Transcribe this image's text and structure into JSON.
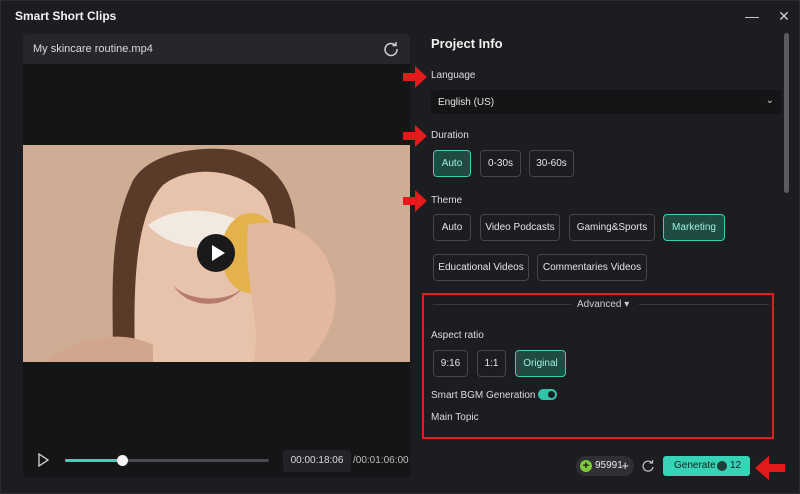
{
  "window": {
    "title": "Smart Short Clips",
    "minimize_label": "—",
    "close_label": "✕"
  },
  "video": {
    "file_name": "My skincare routine.mp4",
    "progress_fraction": 0.28,
    "current_time": "00:00:18:06",
    "total_time": "/00:01:06:00"
  },
  "project": {
    "title": "Project Info",
    "language": {
      "label": "Language",
      "value": "English (US)"
    },
    "duration": {
      "label": "Duration",
      "options": [
        "Auto",
        "0-30s",
        "30-60s"
      ],
      "selected": "Auto"
    },
    "theme": {
      "label": "Theme",
      "options": [
        "Auto",
        "Video Podcasts",
        "Gaming&Sports",
        "Marketing",
        "Educational Videos",
        "Commentaries Videos"
      ],
      "selected": "Marketing"
    },
    "advanced": {
      "label": "Advanced ▾",
      "aspect_ratio": {
        "label": "Aspect ratio",
        "options": [
          "9:16",
          "1:1",
          "Original"
        ],
        "selected": "Original"
      },
      "bgm": {
        "label": "Smart BGM Generation",
        "enabled": true
      },
      "main_topic": {
        "label": "Main Topic"
      }
    }
  },
  "footer": {
    "credits": "95991",
    "credits_add": "+",
    "generate_label": "Generate",
    "generate_cost": "12"
  },
  "colors": {
    "accent": "#37d3b6",
    "highlight": "#e02020",
    "background": "#1c1d20"
  }
}
